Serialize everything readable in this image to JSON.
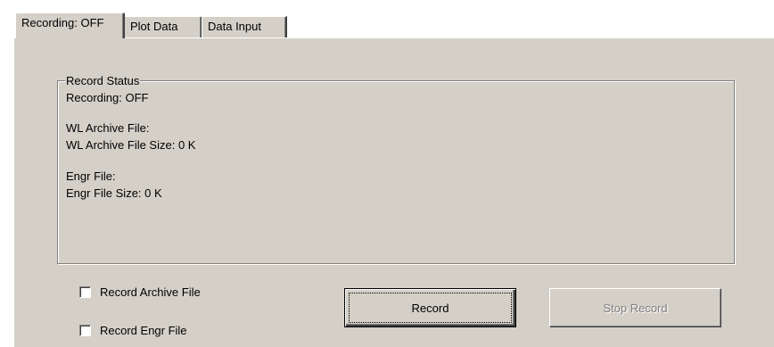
{
  "tabs": [
    {
      "label": "Recording:  OFF",
      "active": true
    },
    {
      "label": "Plot Data",
      "active": false
    },
    {
      "label": "Data Input",
      "active": false
    }
  ],
  "record_status": {
    "title": "Record Status",
    "recording": "Recording:  OFF",
    "wl_archive_file": "WL Archive File:",
    "wl_archive_file_size": "WL Archive File Size:  0 K",
    "engr_file": "Engr File:",
    "engr_file_size": "Engr File Size:  0 K"
  },
  "options": {
    "record_archive_file": {
      "label": "Record Archive File",
      "checked": false
    },
    "record_engr_file": {
      "label": "Record Engr File",
      "checked": false
    }
  },
  "buttons": {
    "record": {
      "label": "Record",
      "enabled": true
    },
    "stop_record": {
      "label": "Stop Record",
      "enabled": false
    }
  },
  "colors": {
    "face": "#d4d0c8",
    "shadow": "#808080",
    "highlight": "#ffffff",
    "disabled_text": "#808080"
  }
}
